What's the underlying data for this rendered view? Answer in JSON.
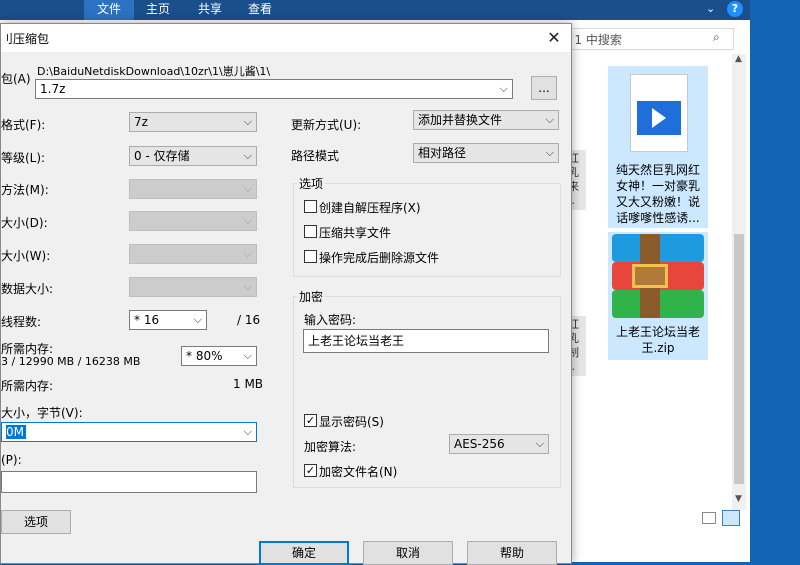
{
  "explorer": {
    "ribbon_tabs": [
      "文件",
      "主页",
      "共享",
      "查看"
    ],
    "search_placeholder": "E 1 中搜索",
    "files": [
      {
        "name": "纯天然巨乳网红女神！一对豪乳又大又粉嫩！说话嗲嗲性感诱..."
      },
      {
        "name": "上老王论坛当老王.zip"
      }
    ],
    "partial_left_glyphs_a": "红\n乳\n来\n..",
    "partial_left_glyphs_b": "红\n乳\n制\n.."
  },
  "dialog": {
    "title": "刂压缩包",
    "archive_label": "包(A)",
    "archive_path": "D:\\BaiduNetdiskDownload\\10zr\\1\\崽儿酱\\1\\",
    "archive_name": "1.7z",
    "browse_label": "...",
    "format_label": "格式(F):",
    "format_value": "7z",
    "level_label": "等级(L):",
    "level_value": "0 - 仅存储",
    "method_label": "方法(M):",
    "dict_label": "大小(D):",
    "word_label": "大小(W):",
    "solid_label": "数据大小:",
    "threads_label": "线程数:",
    "threads_value": "* 16",
    "threads_max": "/ 16",
    "mem_compress_label": "所需内存:",
    "mem_compress_value": "3 / 12990 MB / 16238 MB",
    "mem_percent": "* 80%",
    "mem_decompress_label": "所需内存:",
    "mem_decompress_value": "1 MB",
    "split_label": "大小，字节(V):",
    "split_value": "0M",
    "params_label": "(P):",
    "params_value": "",
    "options_button": "选项",
    "update_label": "更新方式(U):",
    "update_value": "添加并替换文件",
    "path_mode_label": "路径模式",
    "path_mode_value": "相对路径",
    "options_group": "选项",
    "opt_sfx": "创建自解压程序(X)",
    "opt_shared": "压缩共享文件",
    "opt_delete": "操作完成后删除源文件",
    "encrypt_group": "加密",
    "password_label": "输入密码:",
    "password_value": "上老王论坛当老王",
    "show_password": "显示密码(S)",
    "enc_method_label": "加密算法:",
    "enc_method_value": "AES-256",
    "encrypt_names": "加密文件名(N)",
    "ok": "确定",
    "cancel": "取消",
    "help": "帮助"
  },
  "colors": {
    "accent": "#0078d7",
    "ribbon": "#1a4f8b",
    "desktop": "#1464b4",
    "selection": "#cce8ff"
  }
}
